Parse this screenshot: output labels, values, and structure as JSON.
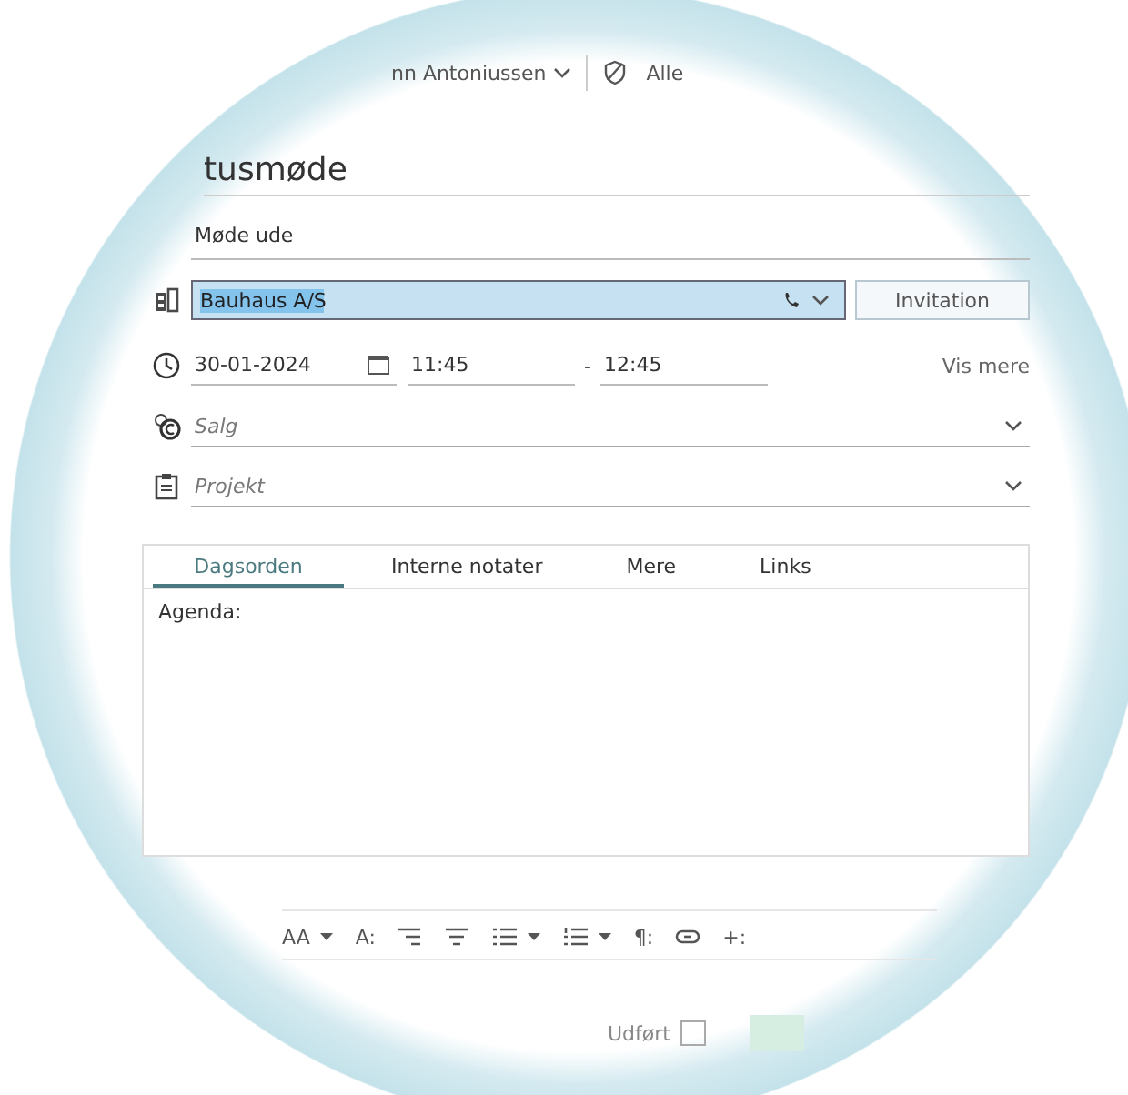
{
  "header": {
    "owner": "nn Antoniussen",
    "visibility": "Alle"
  },
  "subject": {
    "value": "tusmøde"
  },
  "location": {
    "value": "Møde ude"
  },
  "company": {
    "value": "Bauhaus A/S",
    "selected": true
  },
  "invitation_button": "Invitation",
  "time": {
    "date": "30-01-2024",
    "start": "11:45",
    "separator": "-",
    "end": "12:45",
    "more_link": "Vis mere"
  },
  "dropdowns": [
    {
      "kind": "sales",
      "placeholder": "Salg"
    },
    {
      "kind": "project",
      "placeholder": "Projekt"
    }
  ],
  "tabs": [
    {
      "label": "Dagsorden",
      "selected": true
    },
    {
      "label": "Interne notater",
      "selected": false
    },
    {
      "label": "Mere",
      "selected": false
    },
    {
      "label": "Links",
      "selected": false
    }
  ],
  "editor": {
    "text": "Agenda:"
  },
  "toolbar": [
    {
      "kind": "text",
      "label": "AA"
    },
    {
      "kind": "caret"
    },
    {
      "kind": "text",
      "label": "A:"
    },
    {
      "kind": "align-right"
    },
    {
      "kind": "align-center"
    },
    {
      "kind": "bullets"
    },
    {
      "kind": "caret"
    },
    {
      "kind": "numbers"
    },
    {
      "kind": "caret"
    },
    {
      "kind": "text",
      "label": "¶:"
    },
    {
      "kind": "link"
    },
    {
      "kind": "text",
      "label": "+:"
    }
  ],
  "footer": {
    "done_label": "Udført",
    "done_checked": false
  }
}
